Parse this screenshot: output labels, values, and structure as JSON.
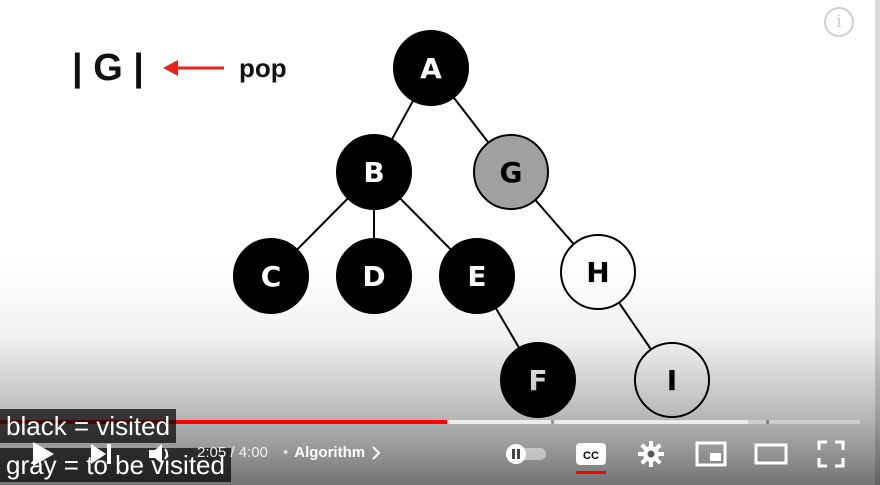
{
  "slide": {
    "stack_text": "| G |",
    "arrow_label": "pop",
    "nodes": [
      {
        "label": "A",
        "state": "visited"
      },
      {
        "label": "B",
        "state": "visited"
      },
      {
        "label": "G",
        "state": "to-be-visited"
      },
      {
        "label": "C",
        "state": "visited"
      },
      {
        "label": "D",
        "state": "visited"
      },
      {
        "label": "E",
        "state": "visited"
      },
      {
        "label": "H",
        "state": "unvisited"
      },
      {
        "label": "F",
        "state": "visited"
      },
      {
        "label": "I",
        "state": "unvisited"
      }
    ],
    "edges": [
      [
        "A",
        "B"
      ],
      [
        "A",
        "G"
      ],
      [
        "B",
        "C"
      ],
      [
        "B",
        "D"
      ],
      [
        "B",
        "E"
      ],
      [
        "E",
        "F"
      ],
      [
        "G",
        "H"
      ],
      [
        "H",
        "I"
      ]
    ],
    "colors": {
      "visited": "#000000",
      "to_be_visited": "#a0a0a0",
      "unvisited": "#ffffff",
      "arrow": "#e8231a"
    }
  },
  "captions": {
    "line1": "black = visited",
    "line2": "gray = to be visited"
  },
  "player": {
    "info_icon": "i",
    "time_display": "2:05 / 4:00",
    "chapter_separator": "•",
    "chapter_title": "Algorithm",
    "progress_fraction": 0.52,
    "buffer_fraction": 0.87,
    "accent_color": "#ff0000",
    "icons": [
      "play-icon",
      "next-icon",
      "volume-icon",
      "chevron-right-icon",
      "autoplay-toggle-icon",
      "captions-icon",
      "settings-gear-icon",
      "miniplayer-icon",
      "theater-mode-icon",
      "fullscreen-icon"
    ],
    "cc_label": "CC"
  }
}
